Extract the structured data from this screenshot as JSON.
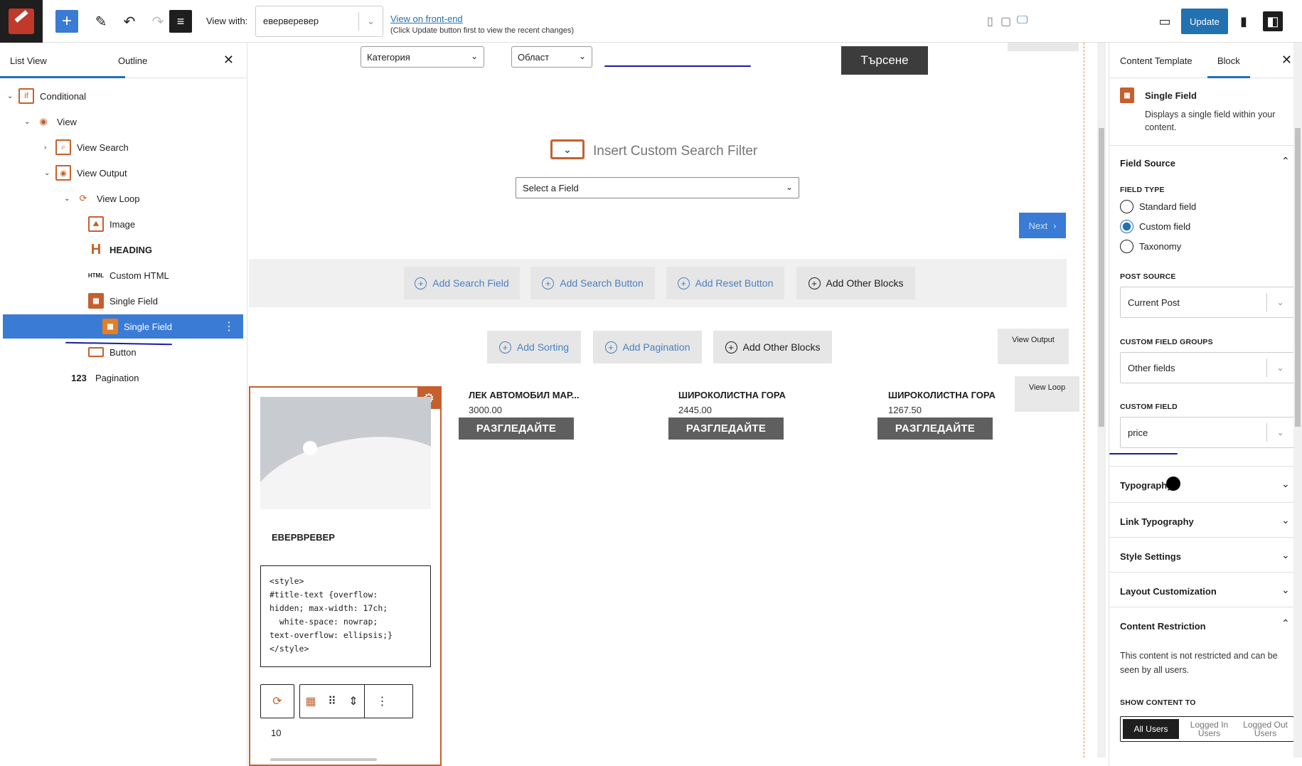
{
  "toolbar": {
    "view_with_label": "View with:",
    "view_with_value": "еверверевер",
    "front_end_link": "View on front-end",
    "front_end_note": "(Click Update button first to view the recent changes)",
    "update_label": "Update"
  },
  "left_panel": {
    "tab_list": "List View",
    "tab_outline": "Outline",
    "tree": [
      {
        "label": "Conditional",
        "icon": "conditional-icon"
      },
      {
        "label": "View",
        "icon": "view-icon"
      },
      {
        "label": "View Search",
        "icon": "search-icon"
      },
      {
        "label": "View Output",
        "icon": "eye-icon"
      },
      {
        "label": "View Loop",
        "icon": "loop-icon"
      },
      {
        "label": "Image",
        "icon": "image-icon"
      },
      {
        "label": "HEADING",
        "icon": "heading-icon"
      },
      {
        "label": "Custom HTML",
        "icon": "html-icon"
      },
      {
        "label": "Single Field",
        "icon": "calendar-icon"
      },
      {
        "label": "Single Field",
        "icon": "calendar-icon"
      },
      {
        "label": "Button",
        "icon": "button-icon"
      },
      {
        "label": "Pagination",
        "icon": "pagination-icon"
      }
    ]
  },
  "canvas": {
    "select_category": "Категория",
    "select_region": "Област",
    "search_button": "Търсене",
    "insert_filter_title": "Insert Custom Search Filter",
    "field_select": "Select a Field",
    "next_label": "Next",
    "add_search_field": "Add Search Field",
    "add_search_button": "Add Search Button",
    "add_reset_button": "Add Reset Button",
    "add_other_blocks": "Add Other Blocks",
    "add_sorting": "Add Sorting",
    "add_pagination": "Add Pagination",
    "add_other_blocks_2": "Add Other Blocks",
    "view_output_label": "View Output",
    "view_loop_label": "View Loop",
    "card_title": "ЕВЕРВРЕВЕР",
    "code": "<style>\n#title-text {overflow:\nhidden; max-width: 17ch;\n  white-space: nowrap;\ntext-overflow: ellipsis;}\n</style>",
    "number": "10",
    "products": [
      {
        "title": "ЛЕК АВТОМОБИЛ МАР...",
        "price": "3000.00",
        "button": "РАЗГЛЕДАЙТЕ"
      },
      {
        "title": "ШИРОКОЛИСТНА ГОРА",
        "price": "2445.00",
        "button": "РАЗГЛЕДАЙТЕ"
      },
      {
        "title": "ШИРОКОЛИСТНА ГОРА",
        "price": "1267.50",
        "button": "РАЗГЛЕДАЙТЕ"
      }
    ]
  },
  "right_panel": {
    "tab_content_template": "Content Template",
    "tab_block": "Block",
    "block_name": "Single Field",
    "block_desc": "Displays a single field within your content.",
    "field_source": "Field Source",
    "field_type_caption": "FIELD TYPE",
    "field_types": [
      "Standard field",
      "Custom field",
      "Taxonomy"
    ],
    "selected_field_type": "Custom field",
    "post_source_caption": "POST SOURCE",
    "post_source_value": "Current Post",
    "custom_field_groups_caption": "CUSTOM FIELD GROUPS",
    "custom_field_groups_value": "Other fields",
    "custom_field_caption": "CUSTOM FIELD",
    "custom_field_value": "price",
    "typography": "Typography",
    "link_typography": "Link Typography",
    "style_settings": "Style Settings",
    "layout_customization": "Layout Customization",
    "content_restriction": "Content Restriction",
    "restriction_text": "This content is not restricted and can be seen by all users.",
    "show_content_caption": "SHOW CONTENT TO",
    "show_content_options": [
      "All Users",
      "Logged In Users",
      "Logged Out Users"
    ],
    "show_content_selected": "All Users"
  },
  "colors": {
    "accent": "#2271b1",
    "brand_orange": "#c5602e",
    "annotation_ink": "#1a1aa8"
  }
}
